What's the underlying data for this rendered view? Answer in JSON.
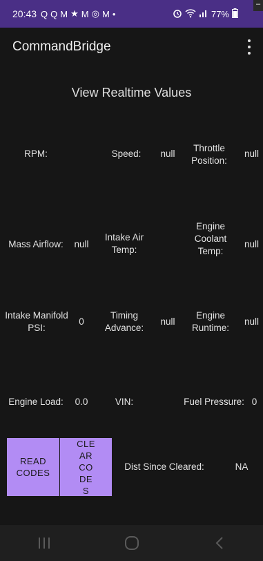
{
  "status_bar": {
    "time": "20:43",
    "notification_glyphs": [
      "Q",
      "Q",
      "M",
      "★",
      "M",
      "◎",
      "M",
      "•"
    ],
    "battery": "77%"
  },
  "app_bar": {
    "title": "CommandBridge"
  },
  "page_heading": "View Realtime Values",
  "readings": {
    "rpm": {
      "label": "RPM:",
      "value": ""
    },
    "speed": {
      "label": "Speed:",
      "value": "null"
    },
    "throttle": {
      "label": "Throttle Position:",
      "value": "null"
    },
    "mass_airflow": {
      "label": "Mass Airflow:",
      "value": "null"
    },
    "intake_air_temp": {
      "label": "Intake Air Temp:",
      "value": ""
    },
    "coolant_temp": {
      "label": "Engine Coolant Temp:",
      "value": "null"
    },
    "manifold_psi": {
      "label": "Intake Manifold PSI:",
      "value": "0"
    },
    "timing_advance": {
      "label": "Timing Advance:",
      "value": "null"
    },
    "runtime": {
      "label": "Engine Runtime:",
      "value": "null"
    },
    "engine_load": {
      "label": "Engine Load:",
      "value": "0.0"
    },
    "vin": {
      "label": "VIN:",
      "value": ""
    },
    "fuel_pressure": {
      "label": "Fuel Pressure:",
      "value": "0"
    },
    "dist_since_cleared": {
      "label": "Dist Since Cleared:",
      "value": "NA"
    }
  },
  "buttons": {
    "read_codes": "READ CODES",
    "clear_codes": "CLEAR CODES"
  }
}
